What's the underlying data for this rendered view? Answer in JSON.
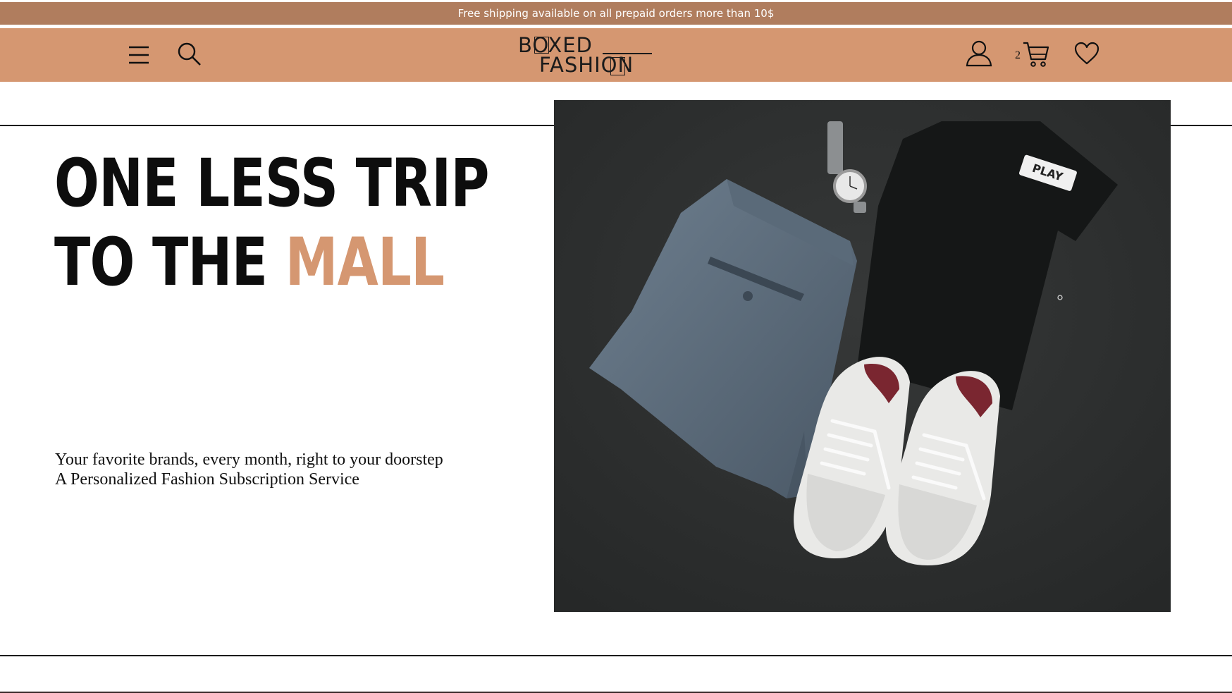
{
  "announcement": {
    "text": "Free shipping available on all prepaid orders more than 10$"
  },
  "header": {
    "logo_line1": "BOXED",
    "logo_line2": "FASHION",
    "cart_count": "2",
    "icons": {
      "menu": "menu-icon",
      "search": "search-icon",
      "account": "user-icon",
      "cart": "cart-icon",
      "wishlist": "heart-icon"
    }
  },
  "hero": {
    "headline_line1": "ONE LESS TRIP",
    "headline_line2_prefix": "TO THE ",
    "headline_line2_accent": "MALL",
    "subtitle_line1": "Your favorite brands, every month, right to your doorstep",
    "subtitle_line2": "A Personalized Fashion Subscription Service",
    "image_label_text": "PLAY"
  },
  "colors": {
    "announcement_bg": "#b07d5e",
    "nav_bg": "#d59771",
    "accent": "#d59771",
    "text": "#0d0d0d"
  }
}
